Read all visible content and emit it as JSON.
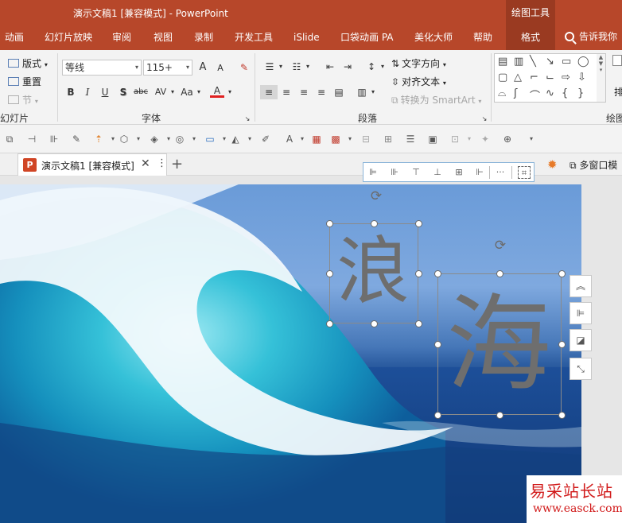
{
  "window": {
    "title": "演示文稿1 [兼容模式] - PowerPoint",
    "context_group": "绘图工具"
  },
  "tabs": [
    {
      "label": "动画"
    },
    {
      "label": "幻灯片放映"
    },
    {
      "label": "审阅"
    },
    {
      "label": "视图"
    },
    {
      "label": "录制"
    },
    {
      "label": "开发工具"
    },
    {
      "label": "iSlide"
    },
    {
      "label": "口袋动画 PA"
    },
    {
      "label": "美化大师"
    },
    {
      "label": "帮助"
    },
    {
      "label": "格式"
    }
  ],
  "tell_me": "告诉我你",
  "ribbon": {
    "slides": {
      "layout": "版式",
      "reset": "重置",
      "section": "节",
      "label": "幻灯片"
    },
    "font": {
      "font_name": "等线",
      "font_size": "115+",
      "grow": "A",
      "shrink": "A",
      "bold": "B",
      "italic": "I",
      "underline": "U",
      "shadow": "S",
      "strike": "abc",
      "spacing": "AV",
      "case": "Aa",
      "color": "A",
      "label": "字体"
    },
    "paragraph": {
      "text_direction": "文字方向",
      "align_text": "对齐文本",
      "smartart": "转换为 SmartArt",
      "label": "段落"
    },
    "drawing": {
      "arrange": "排",
      "label": "绘图"
    }
  },
  "doc": {
    "tab_name": "演示文稿1 [兼容模式]",
    "app_badge": "P",
    "multi_window": "多窗口模"
  },
  "slide": {
    "text_box_1": "浪",
    "text_box_2": "海"
  },
  "watermark": {
    "name": "易采站长站",
    "url": "www.easck.com"
  },
  "colors": {
    "accent": "#b7472a",
    "context_tab": "#9a3a21",
    "glyph": "#6e6e6e",
    "watermark": "#d11a1a"
  }
}
